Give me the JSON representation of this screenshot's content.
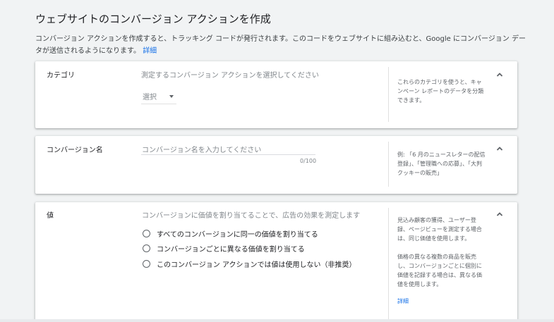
{
  "page": {
    "title": "ウェブサイトのコンバージョン アクションを作成",
    "description": "コンバージョン アクションを作成すると、トラッキング コードが発行されます。このコードをウェブサイトに組み込むと、Google にコンバージョン データが送信されるようになります。",
    "details_link": "詳細"
  },
  "category": {
    "label": "カテゴリ",
    "prompt": "測定するコンバージョン アクションを選択してください",
    "select_value": "選択",
    "help": "これらのカテゴリを使うと、キャンペーン レポートのデータを分類できます。"
  },
  "conversion_name": {
    "label": "コンバージョン名",
    "placeholder": "コンバージョン名を入力してください",
    "counter": "0/100",
    "help": "例: 「6 月のニュースレターの配信登録」、「管理職への応募」、「大判クッキーの販売」"
  },
  "value": {
    "label": "値",
    "prompt": "コンバージョンに価値を割り当てることで、広告の効果を測定します",
    "options": [
      "すべてのコンバージョンに同一の価値を割り当てる",
      "コンバージョンごとに異なる価値を割り当てる",
      "このコンバージョン アクションでは値は使用しない（非推奨）"
    ],
    "help1": "見込み顧客の獲得、ユーザー登録、ページビューを測定する場合は、同じ価値を使用します。",
    "help2": "価格の異なる複数の商品を販売し、コンバージョンごとに個別に価値を記録する場合は、異なる価値を使用します。",
    "help_link": "詳細"
  },
  "icons": {
    "collapse": "chevron-up-icon",
    "dropdown": "caret-down-icon",
    "radio": "radio-unchecked-icon"
  },
  "colors": {
    "link": "#1a73e8",
    "background": "#f1f3f4",
    "card": "#ffffff"
  }
}
